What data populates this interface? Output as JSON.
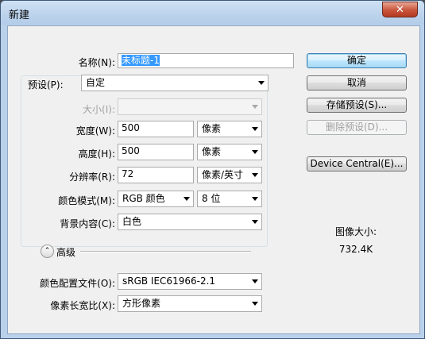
{
  "window": {
    "title": "新建",
    "close_label": "✕"
  },
  "form": {
    "name_label": "名称(N):",
    "name_value": "未标题-1",
    "preset_label": "预设(P):",
    "preset_value": "自定",
    "size_label": "大小(I):",
    "size_value": "",
    "width_label": "宽度(W):",
    "width_value": "500",
    "width_unit": "像素",
    "height_label": "高度(H):",
    "height_value": "500",
    "height_unit": "像素",
    "resolution_label": "分辨率(R):",
    "resolution_value": "72",
    "resolution_unit": "像素/英寸",
    "color_mode_label": "颜色模式(M):",
    "color_mode_value": "RGB 颜色",
    "bit_depth_value": "8 位",
    "background_label": "背景内容(C):",
    "background_value": "白色",
    "advanced_label": "高级",
    "advanced_icon": "chevron-up-icon",
    "color_profile_label": "颜色配置文件(O):",
    "color_profile_value": "sRGB IEC61966-2.1",
    "pixel_aspect_label": "像素长宽比(X):",
    "pixel_aspect_value": "方形像素"
  },
  "buttons": {
    "ok": "确定",
    "cancel": "取消",
    "save_preset": "存储预设(S)...",
    "delete_preset": "删除预设(D)...",
    "device_central": "Device Central(E)..."
  },
  "image_size": {
    "label": "图像大小:",
    "value": "732.4K"
  }
}
